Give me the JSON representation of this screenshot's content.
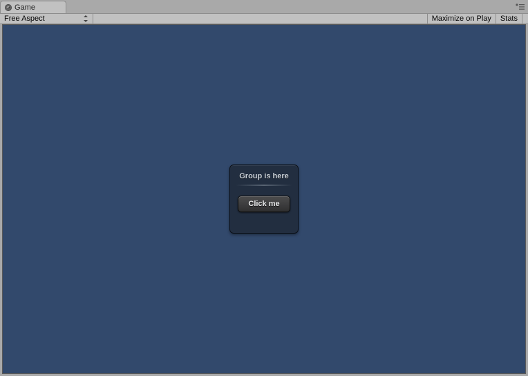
{
  "tab": {
    "label": "Game"
  },
  "toolbar": {
    "aspect_label": "Free Aspect",
    "maximize_label": "Maximize on Play",
    "stats_label": "Stats"
  },
  "gui": {
    "window_title": "Group is here",
    "button_label": "Click me"
  }
}
